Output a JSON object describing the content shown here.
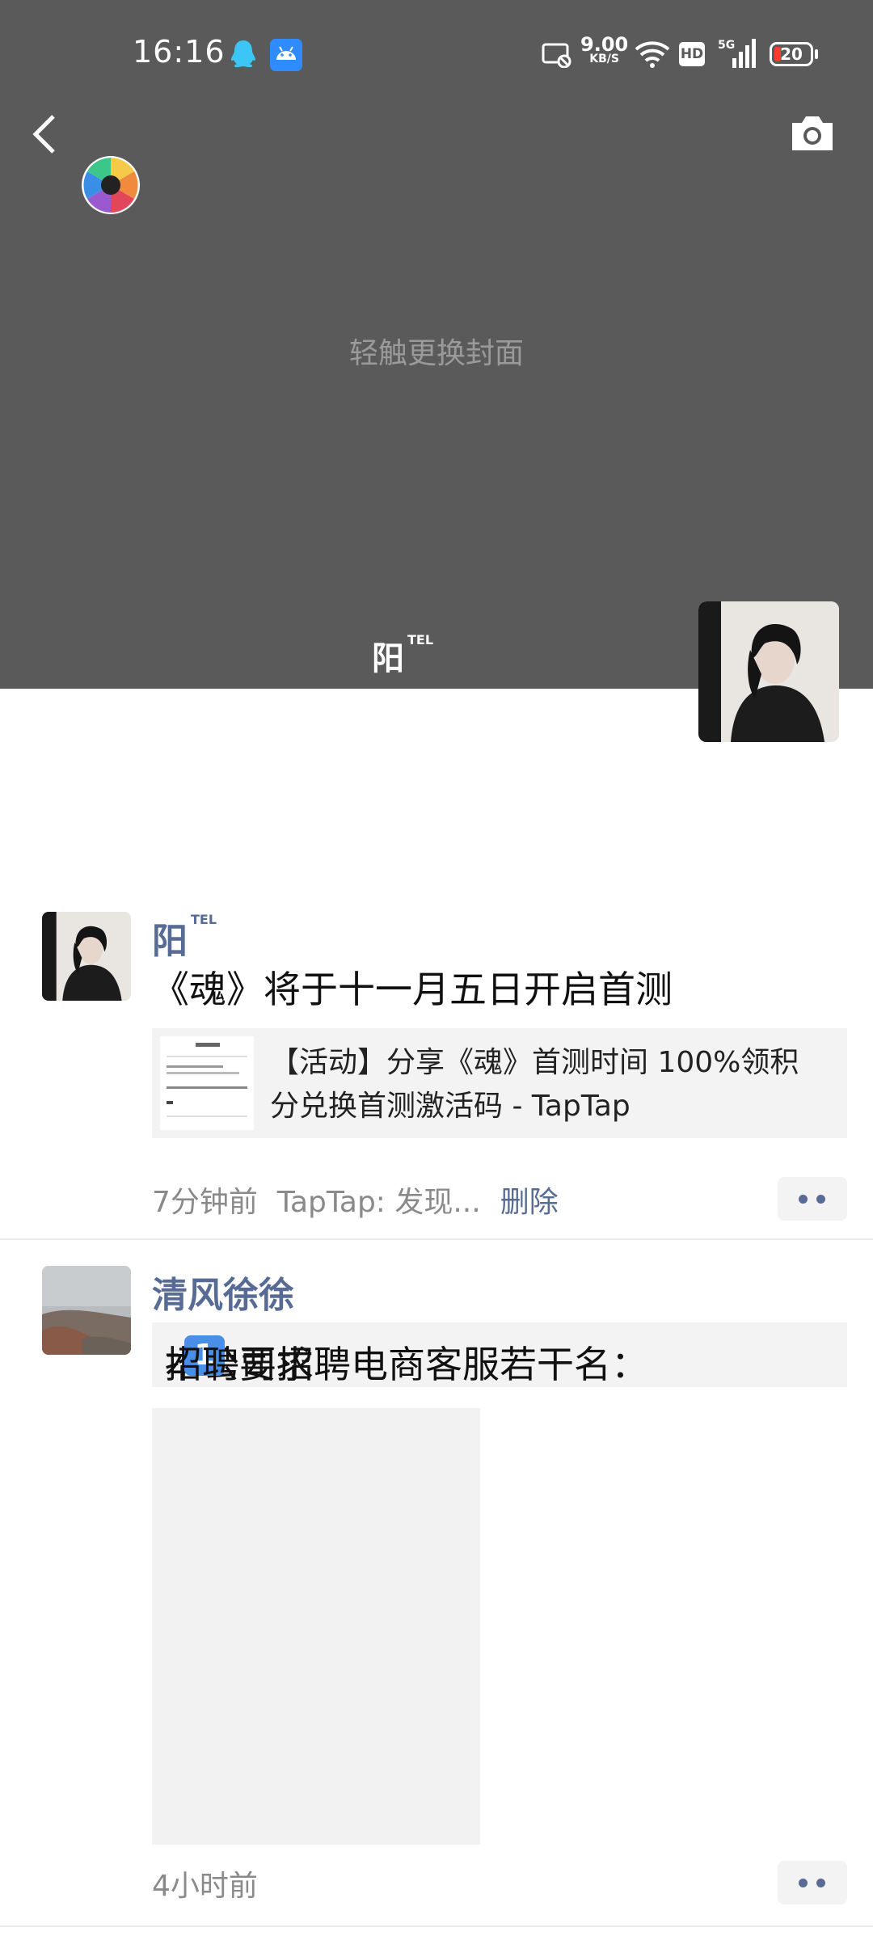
{
  "status_bar": {
    "time": "16:16",
    "net_speed": "9.00",
    "net_speed_unit": "KB/S",
    "hd": "HD",
    "network": "5G",
    "battery": "20",
    "icons": [
      "qq-icon",
      "android-icon",
      "screen-record-icon",
      "wifi-icon",
      "hd-icon",
      "signal-5g-icon",
      "battery-icon"
    ]
  },
  "header": {
    "back_icon": "back-chevron-icon",
    "camera_icon": "camera-icon",
    "cover_hint": "轻触更换封面",
    "profile_name": "阳",
    "profile_name_tag": "TEL"
  },
  "posts": [
    {
      "name": "阳",
      "name_tag": "TEL",
      "text": "《魂》将于十一月五日开启首测",
      "link_title": "【活动】分享《魂》首测时间 100%领积分兑换首测激活码 - TapTap",
      "time": "7分钟前",
      "source": "TapTap: 发现...",
      "delete": "删除"
    },
    {
      "name": "清风徐徐",
      "text": "本公司招聘电商客服若干名：",
      "text_tail": "招聘要求",
      "emoji_number": "1",
      "time": "4小时前"
    }
  ],
  "colors": {
    "cover_bg": "#5a5a5a",
    "name_link": "#576b95",
    "meta_gray": "#8a8a8a",
    "card_bg": "#f3f3f3"
  }
}
